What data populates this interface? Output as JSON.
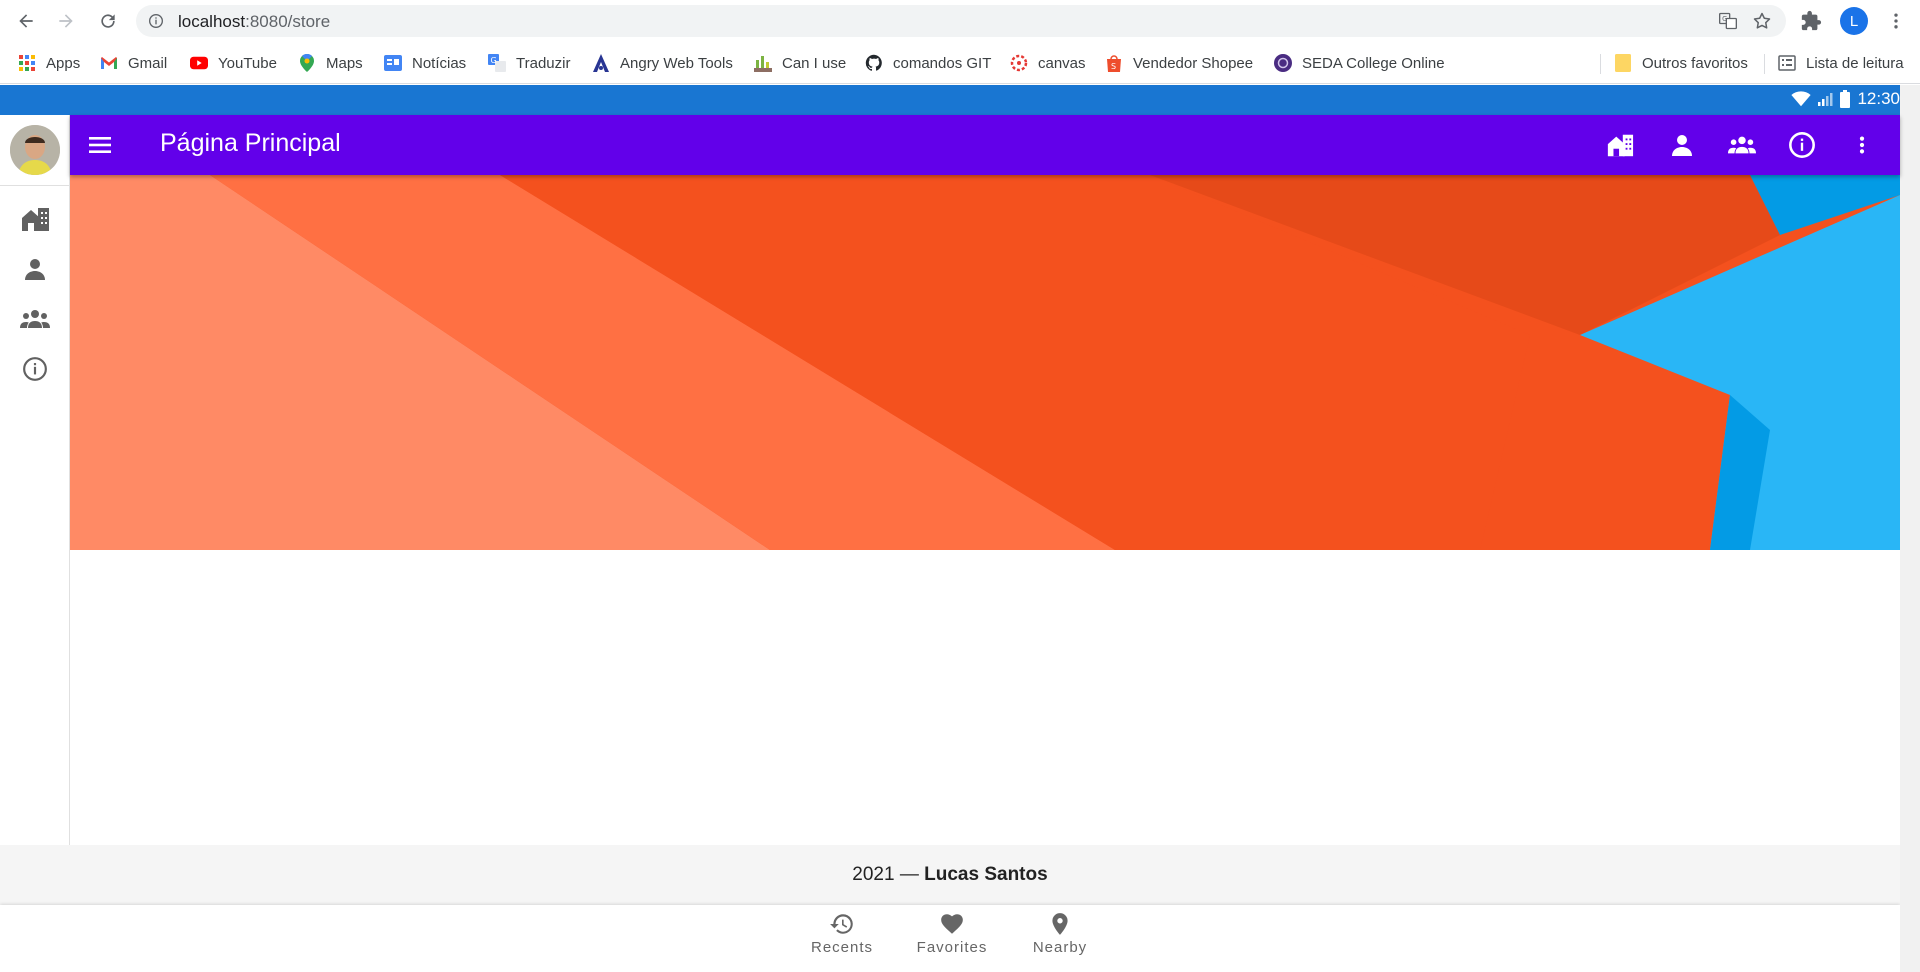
{
  "browser": {
    "url_host": "localhost",
    "url_path": ":8080/store",
    "profile_initial": "L"
  },
  "bookmarks": [
    {
      "label": "Apps",
      "icon": "apps-grid-icon"
    },
    {
      "label": "Gmail",
      "icon": "gmail-icon"
    },
    {
      "label": "YouTube",
      "icon": "youtube-icon"
    },
    {
      "label": "Maps",
      "icon": "maps-pin-icon"
    },
    {
      "label": "Notícias",
      "icon": "news-icon"
    },
    {
      "label": "Traduzir",
      "icon": "translate-icon"
    },
    {
      "label": "Angry Web Tools",
      "icon": "angry-tools-icon"
    },
    {
      "label": "Can I use",
      "icon": "caniuse-icon"
    },
    {
      "label": "comandos GIT",
      "icon": "github-icon"
    },
    {
      "label": "canvas",
      "icon": "canvas-icon"
    },
    {
      "label": "Vendedor Shopee",
      "icon": "shopee-icon"
    },
    {
      "label": "SEDA College Online",
      "icon": "seda-icon"
    }
  ],
  "bookmarks_right": [
    {
      "label": "Outros favoritos",
      "icon": "folder-icon"
    },
    {
      "label": "Lista de leitura",
      "icon": "reading-list-icon"
    }
  ],
  "status_bar": {
    "time": "12:30"
  },
  "app_bar": {
    "title": "Página Principal"
  },
  "colors": {
    "app_bar": "#6200ea",
    "status_bar": "#1976d2",
    "hero_orange": "#f4511e",
    "hero_blue": "#29b6f6"
  },
  "footer": {
    "year": "2021",
    "dash": " — ",
    "author": "Lucas Santos"
  },
  "bottom_nav": [
    {
      "label": "Recents",
      "icon": "history-icon"
    },
    {
      "label": "Favorites",
      "icon": "heart-icon"
    },
    {
      "label": "Nearby",
      "icon": "location-pin-icon"
    }
  ]
}
